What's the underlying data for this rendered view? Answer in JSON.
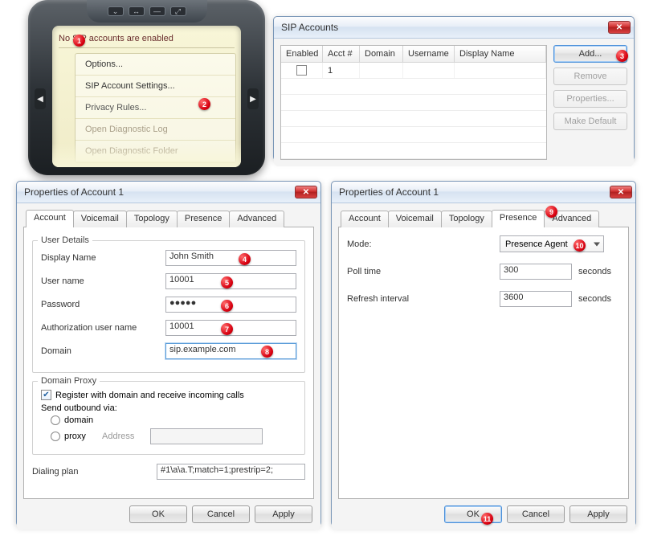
{
  "device": {
    "status": "No SIP accounts are enabled",
    "menu": {
      "options": "Options...",
      "sip_settings": "SIP Account Settings...",
      "privacy": "Privacy Rules...",
      "diag_log": "Open Diagnostic Log",
      "diag_folder": "Open Diagnostic Folder"
    }
  },
  "sip_accounts": {
    "title": "SIP Accounts",
    "headers": {
      "enabled": "Enabled",
      "acct": "Acct #",
      "domain": "Domain",
      "username": "Username",
      "display_name": "Display Name"
    },
    "row1_acct": "1",
    "buttons": {
      "add": "Add...",
      "remove": "Remove",
      "properties": "Properties...",
      "make_default": "Make Default"
    }
  },
  "prop_account": {
    "title": "Properties of Account 1",
    "tabs": {
      "account": "Account",
      "voicemail": "Voicemail",
      "topology": "Topology",
      "presence": "Presence",
      "advanced": "Advanced"
    },
    "user_details_group": "User Details",
    "labels": {
      "display_name": "Display Name",
      "user_name": "User name",
      "password": "Password",
      "auth_user": "Authorization user name",
      "domain": "Domain"
    },
    "values": {
      "display_name": "John Smith",
      "user_name": "10001",
      "password": "●●●●●",
      "auth_user": "10001",
      "domain": "sip.example.com"
    },
    "proxy_group": "Domain Proxy",
    "register_label": "Register with domain and receive incoming calls",
    "send_outbound_label": "Send outbound via:",
    "radio_domain": "domain",
    "radio_proxy": "proxy",
    "address_label": "Address",
    "dialing_plan_label": "Dialing plan",
    "dialing_plan_value": "#1\\a\\a.T;match=1;prestrip=2;",
    "buttons": {
      "ok": "OK",
      "cancel": "Cancel",
      "apply": "Apply"
    }
  },
  "prop_presence": {
    "title": "Properties of Account 1",
    "labels": {
      "mode": "Mode:",
      "poll": "Poll time",
      "refresh": "Refresh interval",
      "seconds": "seconds"
    },
    "values": {
      "mode": "Presence Agent",
      "poll": "300",
      "refresh": "3600"
    }
  },
  "badges": {
    "b1": "1",
    "b2": "2",
    "b3": "3",
    "b4": "4",
    "b5": "5",
    "b6": "6",
    "b7": "7",
    "b8": "8",
    "b9": "9",
    "b10": "10",
    "b11": "11"
  }
}
